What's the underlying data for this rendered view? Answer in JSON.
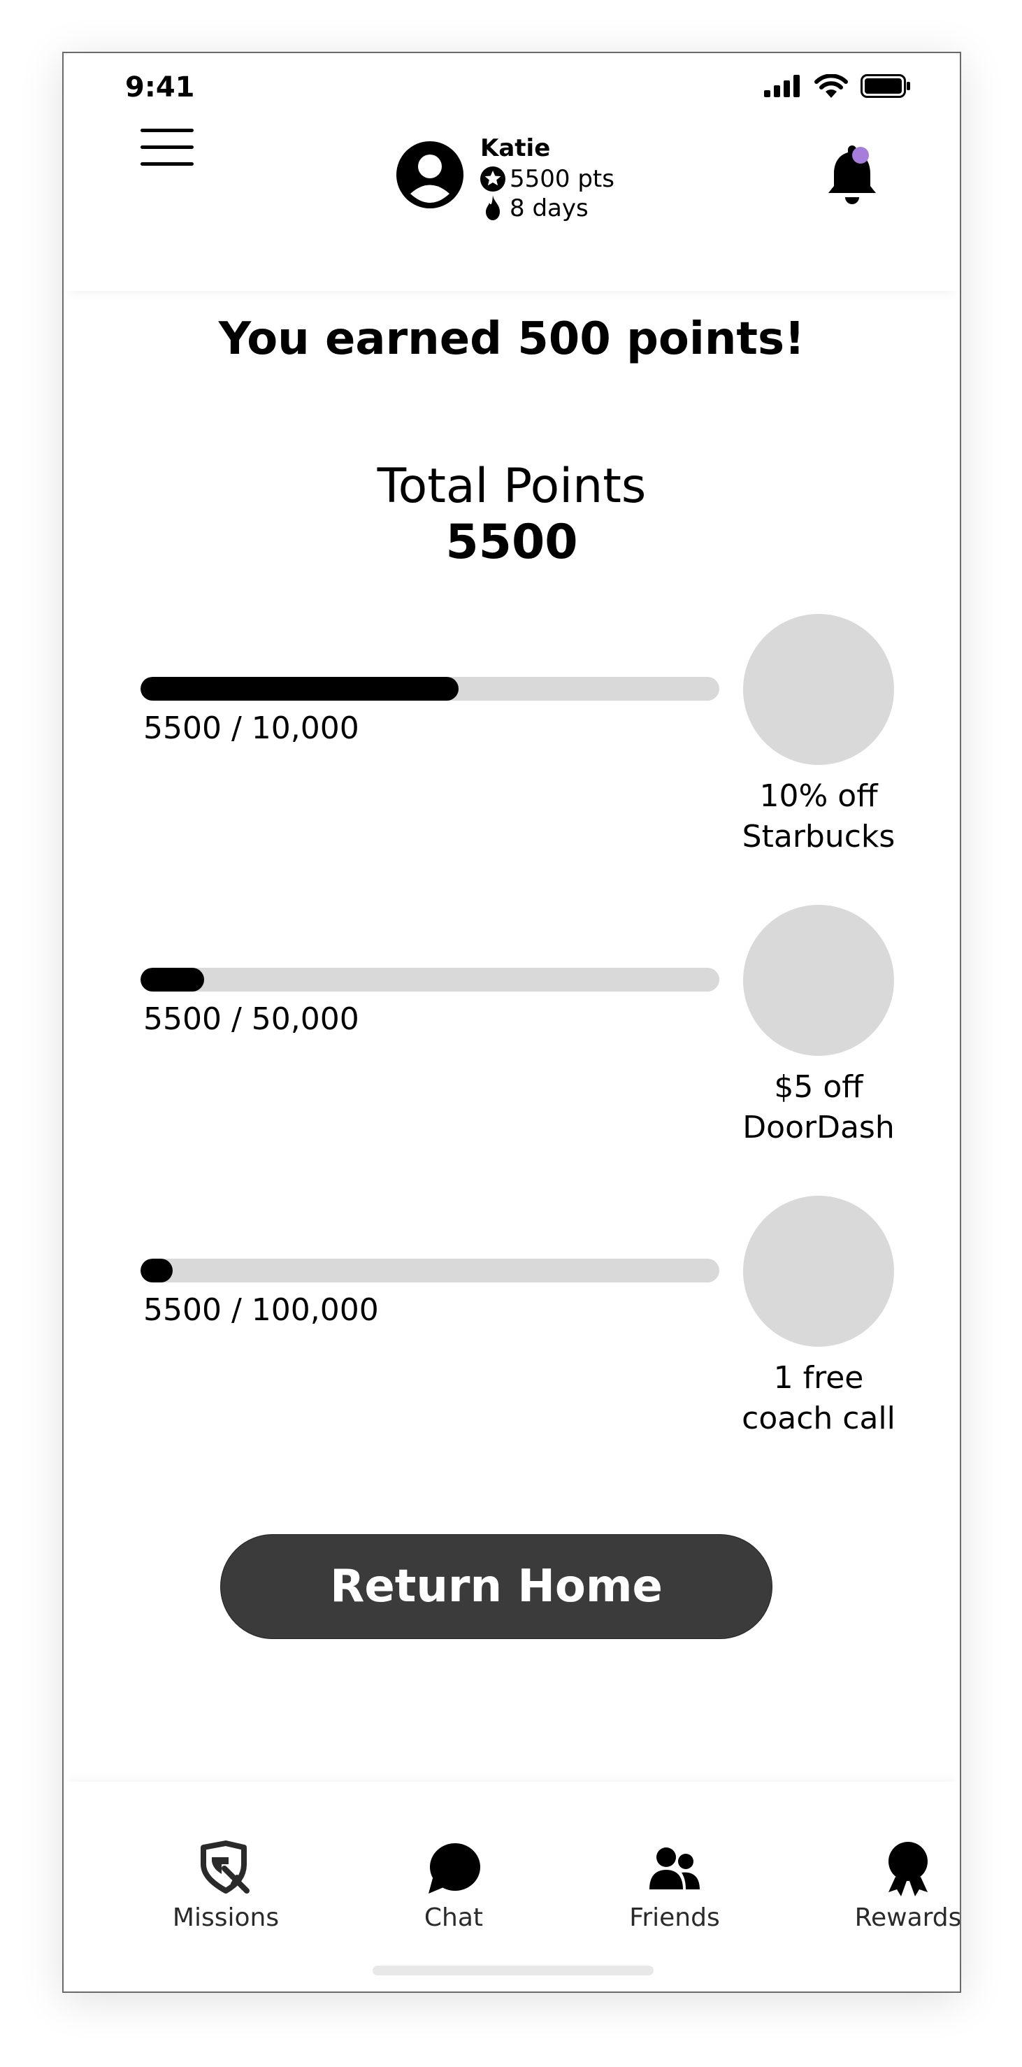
{
  "status_bar": {
    "time": "9:41"
  },
  "header": {
    "user_name": "Katie",
    "points": "5500 pts",
    "streak": "8 days",
    "notification_dot_color": "#a67ddb"
  },
  "main": {
    "headline": "You earned 500 points!",
    "total_label": "Total Points",
    "total_value": "5500",
    "rewards": [
      {
        "progress_text": "5500 / 10,000",
        "progress": 0.55,
        "name": "10% off\nStarbucks"
      },
      {
        "progress_text": "5500 / 50,000",
        "progress": 0.11,
        "name": "$5 off\nDoorDash"
      },
      {
        "progress_text": "5500 / 100,000",
        "progress": 0.055,
        "name": "1 free\ncoach call"
      }
    ],
    "return_button": "Return Home"
  },
  "nav": {
    "items": [
      {
        "label": "Missions",
        "icon": "shield-sword-icon"
      },
      {
        "label": "Chat",
        "icon": "chat-bubble-icon"
      },
      {
        "label": "Friends",
        "icon": "users-icon"
      },
      {
        "label": "Rewards",
        "icon": "award-ribbon-icon"
      }
    ]
  }
}
